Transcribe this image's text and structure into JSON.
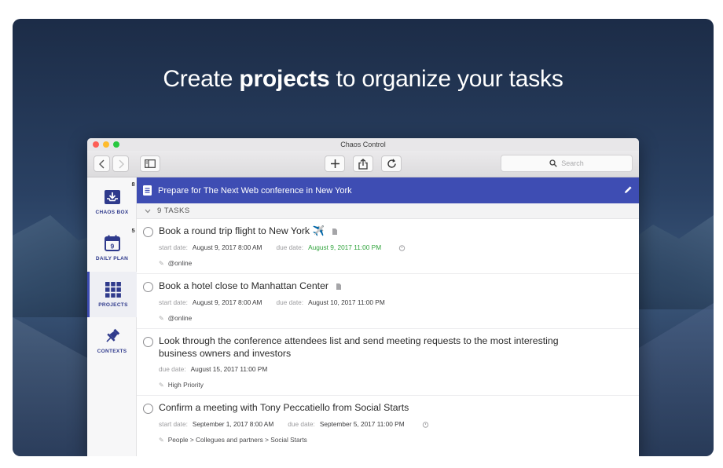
{
  "headline": {
    "pre": "Create ",
    "bold": "projects",
    "post": " to organize your tasks"
  },
  "window": {
    "title": "Chaos Control"
  },
  "search": {
    "placeholder": "Search"
  },
  "sidebar": {
    "items": [
      {
        "label": "CHAOS BOX",
        "badge": "8",
        "icon": "inbox-icon"
      },
      {
        "label": "DAILY PLAN",
        "badge": "5",
        "icon": "calendar-icon",
        "day": "9"
      },
      {
        "label": "PROJECTS",
        "badge": "",
        "icon": "grid-icon"
      },
      {
        "label": "CONTEXTS",
        "badge": "",
        "icon": "pin-icon"
      }
    ]
  },
  "project": {
    "name": "Prepare for The Next Web conference in New York",
    "tasks_count": "9 TASKS"
  },
  "labels": {
    "start": "start date:",
    "due": "due date:"
  },
  "tasks": [
    {
      "title": "Book a round trip flight to New York ✈️",
      "start": "August 9, 2017 8:00 AM",
      "due": "August 9, 2017 11:00 PM",
      "context": "@online"
    },
    {
      "title": "Book a hotel close to Manhattan Center",
      "start": "August 9, 2017 8:00 AM",
      "due": "August 10, 2017 11:00 PM",
      "context": "@online"
    },
    {
      "title": "Look through the conference attendees list and send meeting requests to the most interesting business owners and investors",
      "due": "August 15, 2017 11:00 PM",
      "context": "High Priority"
    },
    {
      "title": "Confirm a meeting with Tony Peccatiello from Social Starts",
      "start": "September 1, 2017 8:00 AM",
      "due": "September 5, 2017 11:00 PM",
      "context": "People > Collegues and partners > Social Starts"
    }
  ],
  "colors": {
    "accent": "#3e4db3",
    "due_overdue": "#2fa33b"
  }
}
